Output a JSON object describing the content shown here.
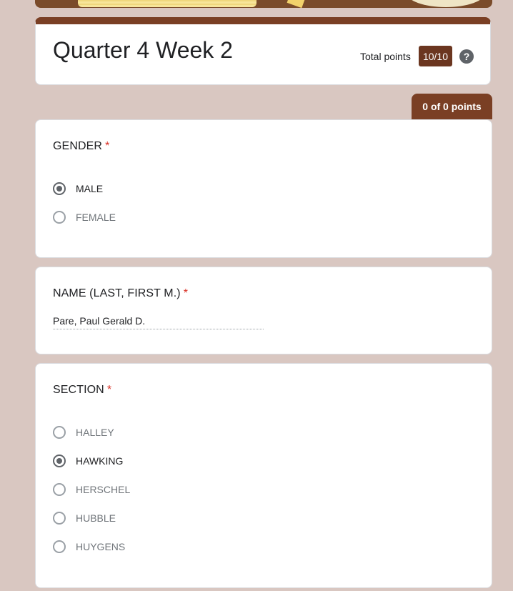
{
  "header": {
    "form_title": "Quarter 4 Week 2",
    "total_points_label": "Total points",
    "total_points_value": "10/10",
    "help_icon": "?"
  },
  "score_tab": {
    "text": "0 of 0 points"
  },
  "questions": {
    "gender": {
      "title": "GENDER",
      "required_mark": "*",
      "options": [
        {
          "label": "MALE",
          "selected": true
        },
        {
          "label": "FEMALE",
          "selected": false
        }
      ]
    },
    "name": {
      "title": "NAME (LAST, FIRST M.)",
      "required_mark": "*",
      "answer": "Pare, Paul Gerald D."
    },
    "section": {
      "title": "SECTION",
      "required_mark": "*",
      "options": [
        {
          "label": "HALLEY",
          "selected": false
        },
        {
          "label": "HAWKING",
          "selected": true
        },
        {
          "label": "HERSCHEL",
          "selected": false
        },
        {
          "label": "HUBBLE",
          "selected": false
        },
        {
          "label": "HUYGENS",
          "selected": false
        }
      ]
    }
  },
  "colors": {
    "theme": "#7a3f24",
    "background": "#d9c7c1",
    "required": "#d93025"
  }
}
